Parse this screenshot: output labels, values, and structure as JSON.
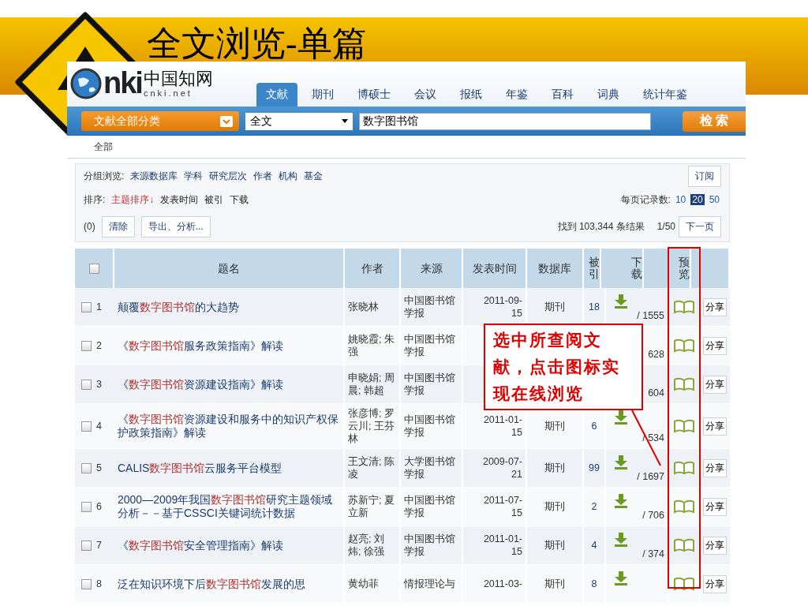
{
  "slide": {
    "title": "全文浏览-单篇"
  },
  "site": {
    "logo": {
      "mark": "nki",
      "chinese": "中国知网",
      "domain": "cnki.net"
    },
    "nav_tabs": [
      {
        "label": "文献",
        "selected": true
      },
      {
        "label": "期刊",
        "selected": false
      },
      {
        "label": "博硕士",
        "selected": false
      },
      {
        "label": "会议",
        "selected": false
      },
      {
        "label": "报纸",
        "selected": false
      },
      {
        "label": "年鉴",
        "selected": false
      },
      {
        "label": "百科",
        "selected": false
      },
      {
        "label": "词典",
        "selected": false
      },
      {
        "label": "统计年鉴",
        "selected": false
      }
    ],
    "search": {
      "category": "文献全部分类",
      "field": "全文",
      "value": "数字图书馆",
      "button": "检 索"
    },
    "breadcrumb": "全部",
    "grouping": {
      "label": "分组浏览:",
      "items": [
        "来源数据库",
        "学科",
        "研究层次",
        "作者",
        "机构",
        "基金"
      ],
      "subscribe": "订阅"
    },
    "sort": {
      "label": "排序:",
      "options": [
        {
          "label": "主题排序↓",
          "selected": true
        },
        {
          "label": "发表时间",
          "selected": false
        },
        {
          "label": "被引",
          "selected": false
        },
        {
          "label": "下载",
          "selected": false
        }
      ]
    },
    "per_page": {
      "label": "每页记录数:",
      "options": [
        {
          "label": "10",
          "selected": false
        },
        {
          "label": "20",
          "selected": true
        },
        {
          "label": "50",
          "selected": false
        }
      ]
    },
    "actions": {
      "count": "(0)",
      "clear": "清除",
      "export": "导出、分析...",
      "found": "找到 103,344 条结果",
      "page": "1/50",
      "next": "下一页"
    },
    "table": {
      "header_checked": false,
      "columns": [
        "题名",
        "作者",
        "来源",
        "发表时间",
        "数据库",
        "被引",
        "下载",
        "预览"
      ],
      "rows": [
        {
          "checked": false,
          "no": "1",
          "title": {
            "before": "颠覆",
            "highlight": "数字图书馆",
            "after": "的大趋势"
          },
          "author": "张晓林",
          "source": "中国图书馆学报",
          "date": "2011-09-15",
          "database": "期刊",
          "cited": "18",
          "downloads": "/ 1555",
          "share": "分享"
        },
        {
          "checked": false,
          "no": "2",
          "title": {
            "before": "《",
            "highlight": "数字图书馆",
            "after": "服务政策指南》解读"
          },
          "author": "姚晓霞; 朱强",
          "source": "中国图书馆学报",
          "downloads": "628",
          "share": "分享"
        },
        {
          "checked": false,
          "no": "3",
          "title": {
            "before": "《",
            "highlight": "数字图书馆",
            "after": "资源建设指南》解读"
          },
          "author": "申晓娟; 周晨; 韩超",
          "source": "中国图书馆学报",
          "downloads": "604",
          "share": "分享"
        },
        {
          "checked": false,
          "no": "4",
          "title": {
            "before": "《",
            "highlight": "数字图书馆",
            "after": "资源建设和服务中的知识产权保护政策指南》解读"
          },
          "author": "张彦博; 罗云川; 王芬林",
          "source": "中国图书馆学报",
          "date": "2011-01-15",
          "database": "期刊",
          "cited": "6",
          "downloads": "/ 534",
          "share": "分享"
        },
        {
          "checked": false,
          "no": "5",
          "title": {
            "before": "CALIS",
            "highlight": "数字图书馆",
            "after": "云服务平台模型"
          },
          "author": "王文清; 陈凌",
          "source": "大学图书馆学报",
          "date": "2009-07-21",
          "database": "期刊",
          "cited": "99",
          "downloads": "/ 1697",
          "share": "分享"
        },
        {
          "checked": false,
          "no": "6",
          "title": {
            "before": "2000—2009年我国",
            "highlight": "数字图书馆",
            "after": "研究主题领域分析－－基于CSSCI关键词统计数据"
          },
          "author": "苏新宁; 夏立新",
          "source": "中国图书馆学报",
          "date": "2011-07-15",
          "database": "期刊",
          "cited": "2",
          "downloads": "/ 706",
          "share": "分享"
        },
        {
          "checked": false,
          "no": "7",
          "title": {
            "before": "《",
            "highlight": "数字图书馆",
            "after": "安全管理指南》解读"
          },
          "author": "赵亮; 刘炜; 徐强",
          "source": "中国图书馆学报",
          "date": "2011-01-15",
          "database": "期刊",
          "cited": "4",
          "downloads": "/ 374",
          "share": "分享"
        },
        {
          "checked": false,
          "no": "8",
          "title": {
            "before": "泛在知识环境下后",
            "highlight": "数字图书馆",
            "after": "发展的思"
          },
          "author": "黄幼菲",
          "source": "情报理论与",
          "date": "2011-03-",
          "database": "期刊",
          "cited": "8",
          "share": "分享"
        }
      ]
    }
  },
  "callout": {
    "text": "选中所查阅文献，点击图标实现在线浏览"
  }
}
